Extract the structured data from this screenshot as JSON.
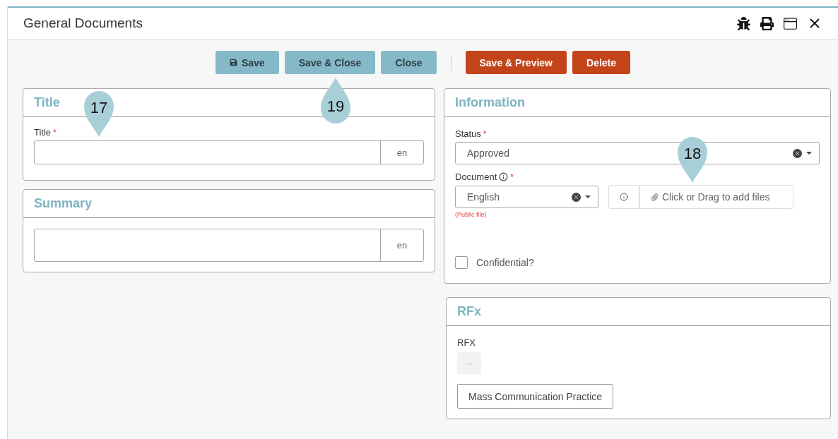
{
  "window": {
    "title": "General Documents"
  },
  "toolbar": {
    "buttons": [
      {
        "label": "Save",
        "kind": "primary",
        "icon": true
      },
      {
        "label": "Save & Close",
        "kind": "primary",
        "icon": false
      },
      {
        "label": "Close",
        "kind": "primary",
        "icon": false
      },
      {
        "label": "Save & Preview",
        "kind": "danger",
        "icon": false
      },
      {
        "label": "Delete",
        "kind": "danger",
        "icon": false
      }
    ]
  },
  "title_section": {
    "heading": "Title",
    "field_label": "Title",
    "required_mark": "*",
    "lang": "en"
  },
  "summary_section": {
    "heading": "Summary",
    "lang": "en"
  },
  "information": {
    "heading": "Information",
    "status_label": "Status",
    "status_required_mark": "*",
    "status_value": "Approved",
    "document_label": "Document",
    "document_required_mark": "*",
    "language_value": "English",
    "file_hint": "(Public file)",
    "upload_placeholder": "Click or Drag to add files",
    "confidential_label": "Confidential?",
    "confidential_checked": false
  },
  "rfx": {
    "heading": "RFx",
    "label": "RFX",
    "more": "···",
    "item": "Mass Communication Practice"
  },
  "markers": [
    {
      "number": "17",
      "kind": "pin_down"
    },
    {
      "number": "19",
      "kind": "pin_up"
    },
    {
      "number": "18",
      "kind": "pin_down"
    }
  ]
}
